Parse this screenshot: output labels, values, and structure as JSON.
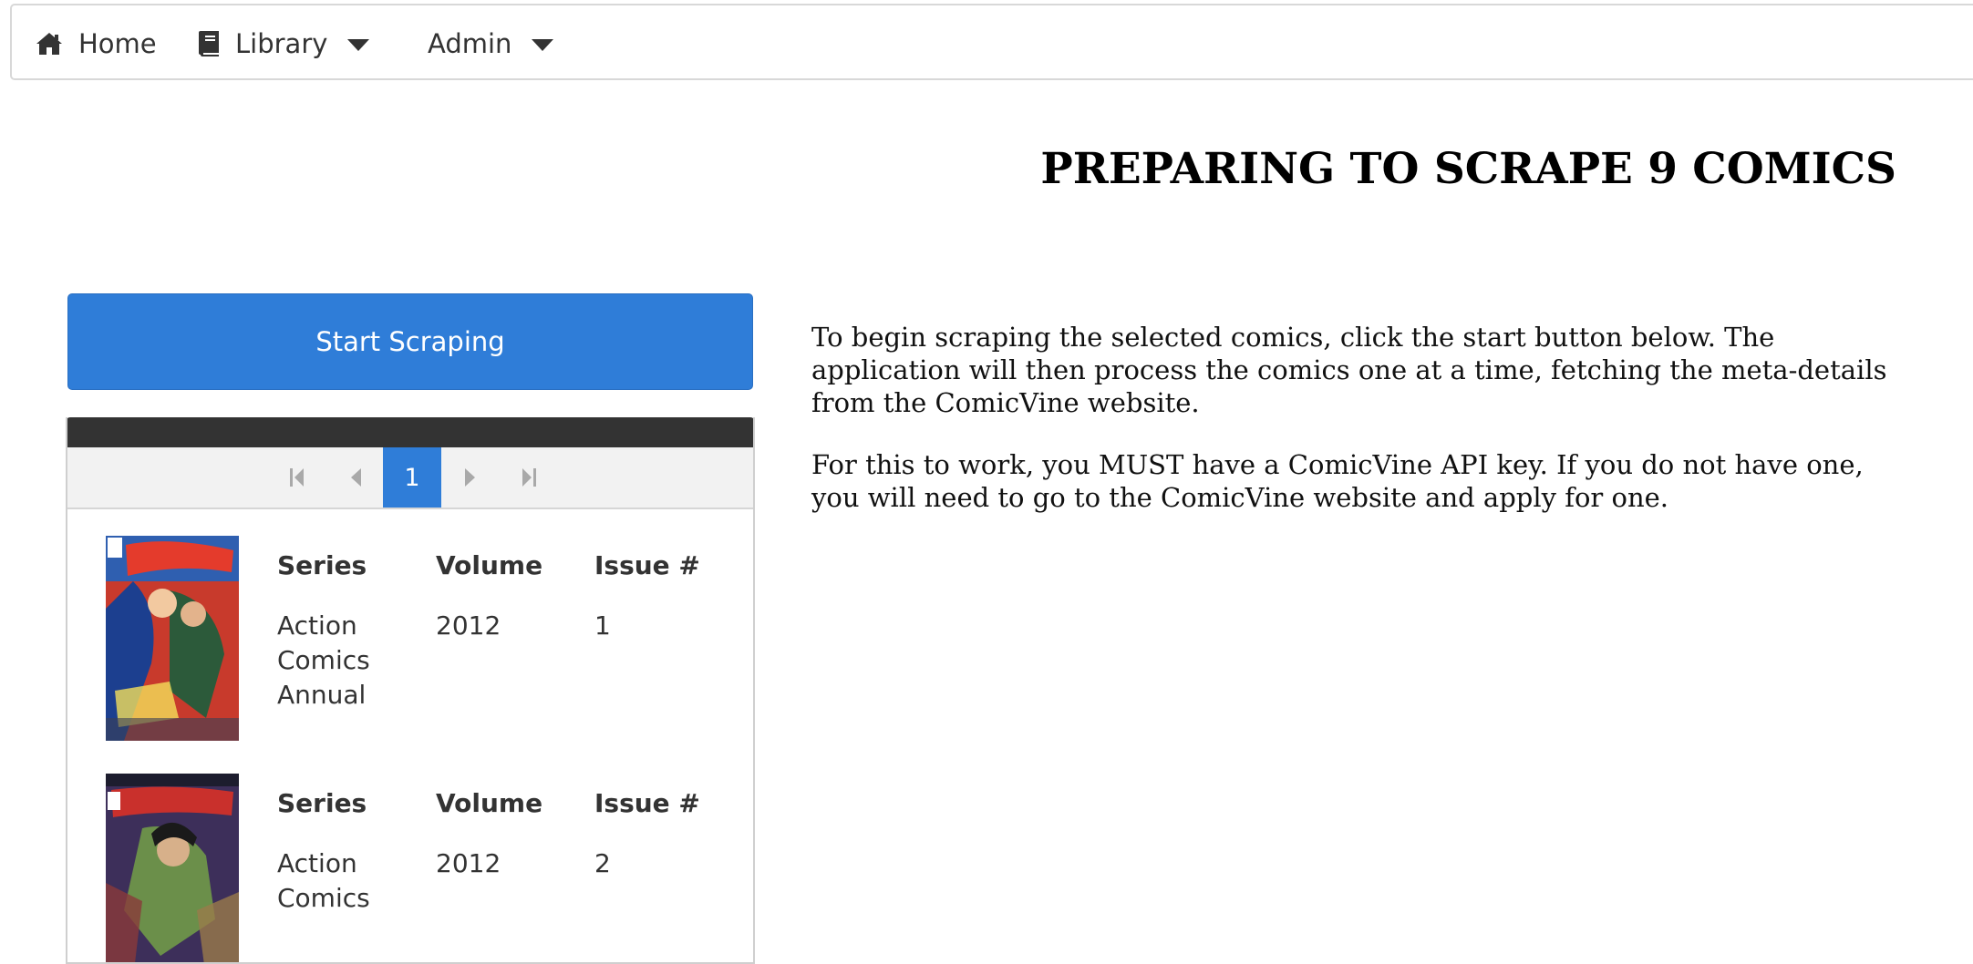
{
  "nav": {
    "home": {
      "label": "Home",
      "icon": "home-icon"
    },
    "library": {
      "label": "Library",
      "icon": "book-icon"
    },
    "admin": {
      "label": "Admin"
    }
  },
  "page": {
    "title": "PREPARING TO SCRAPE 9 COMICS"
  },
  "actions": {
    "start_label": "Start Scraping"
  },
  "pager": {
    "current_page": "1"
  },
  "comics": [
    {
      "series_header": "Series",
      "volume_header": "Volume",
      "issue_header": "Issue #",
      "series": "Action Comics Annual",
      "volume": "2012",
      "issue": "1"
    },
    {
      "series_header": "Series",
      "volume_header": "Volume",
      "issue_header": "Issue #",
      "series": "Action Comics",
      "volume": "2012",
      "issue": "2"
    }
  ],
  "description": {
    "paragraph1": "To begin scraping the selected comics, click the start button below. The application will then process the comics one at a time, fetching the meta-details from the ComicVine website.",
    "paragraph2": "For this to work, you MUST have a ComicVine API key. If you do not have one, you will need to go to the ComicVine website and apply for one."
  },
  "colors": {
    "accent": "#2f7dd8",
    "panel_header": "#333333",
    "pager_bg": "#f2f2f2"
  }
}
